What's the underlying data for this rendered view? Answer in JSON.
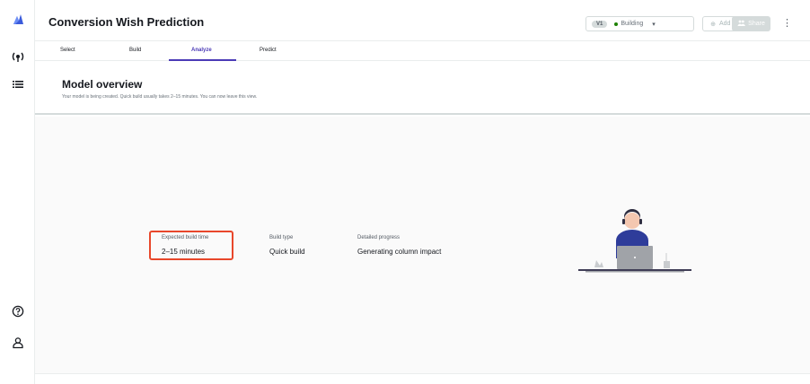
{
  "rail": {
    "icons": [
      "logo-icon",
      "models-icon",
      "list-icon",
      "help-icon",
      "user-icon"
    ]
  },
  "header": {
    "title": "Conversion Wish Prediction",
    "version_label": "V1",
    "status_label": "Building",
    "add_version_label": "Add version",
    "share_label": "Share"
  },
  "tabs": [
    {
      "label": "Select"
    },
    {
      "label": "Build"
    },
    {
      "label": "Analyze"
    },
    {
      "label": "Predict"
    }
  ],
  "active_tab": "Analyze",
  "overview": {
    "title": "Model overview",
    "subtitle": "Your model is being created. Quick build usually takes 2–15 minutes. You can now leave this view."
  },
  "stats": {
    "build_time_label": "Expected build time",
    "build_time_value": "2–15 minutes",
    "build_type_label": "Build type",
    "build_type_value": "Quick build",
    "progress_label": "Detailed progress",
    "progress_value": "Generating column impact"
  },
  "colors": {
    "accent": "#4b3bb7",
    "highlight": "#e8472b",
    "status_dot": "#1d8102",
    "person_shirt": "#2e3c9a"
  }
}
